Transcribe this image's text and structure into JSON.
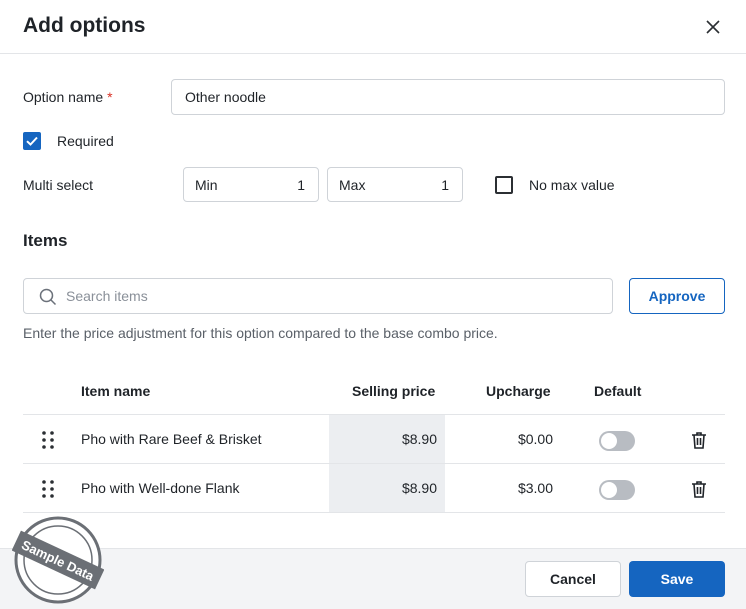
{
  "dialog": {
    "title": "Add options"
  },
  "form": {
    "option_name_label": "Option name",
    "required_marker": "*",
    "option_name_value": "Other noodle",
    "required_label": "Required",
    "required_checked": true,
    "multi_select_label": "Multi select",
    "min_label": "Min",
    "min_value": "1",
    "max_label": "Max",
    "max_value": "1",
    "no_max_label": "No max value",
    "no_max_checked": false
  },
  "items_section": {
    "title": "Items",
    "search_placeholder": "Search items",
    "approve_label": "Approve",
    "hint": "Enter the price adjustment for this option compared to the base combo price."
  },
  "table": {
    "columns": {
      "item_name": "Item name",
      "selling_price": "Selling price",
      "upcharge": "Upcharge",
      "default": "Default"
    },
    "rows": [
      {
        "name": "Pho with Rare Beef & Brisket",
        "selling_price": "$8.90",
        "upcharge": "$0.00",
        "default": false
      },
      {
        "name": "Pho with Well-done Flank",
        "selling_price": "$8.90",
        "upcharge": "$3.00",
        "default": false
      }
    ]
  },
  "footer": {
    "cancel_label": "Cancel",
    "save_label": "Save"
  },
  "watermark": {
    "text": "Sample Data"
  },
  "colors": {
    "accent": "#1565c0",
    "required_star": "#d93025",
    "price_cell_bg": "#eceef1",
    "footer_bg": "#f3f4f6"
  },
  "icons": [
    "close-icon",
    "check-icon",
    "search-icon",
    "drag-handle-icon",
    "trash-icon"
  ]
}
